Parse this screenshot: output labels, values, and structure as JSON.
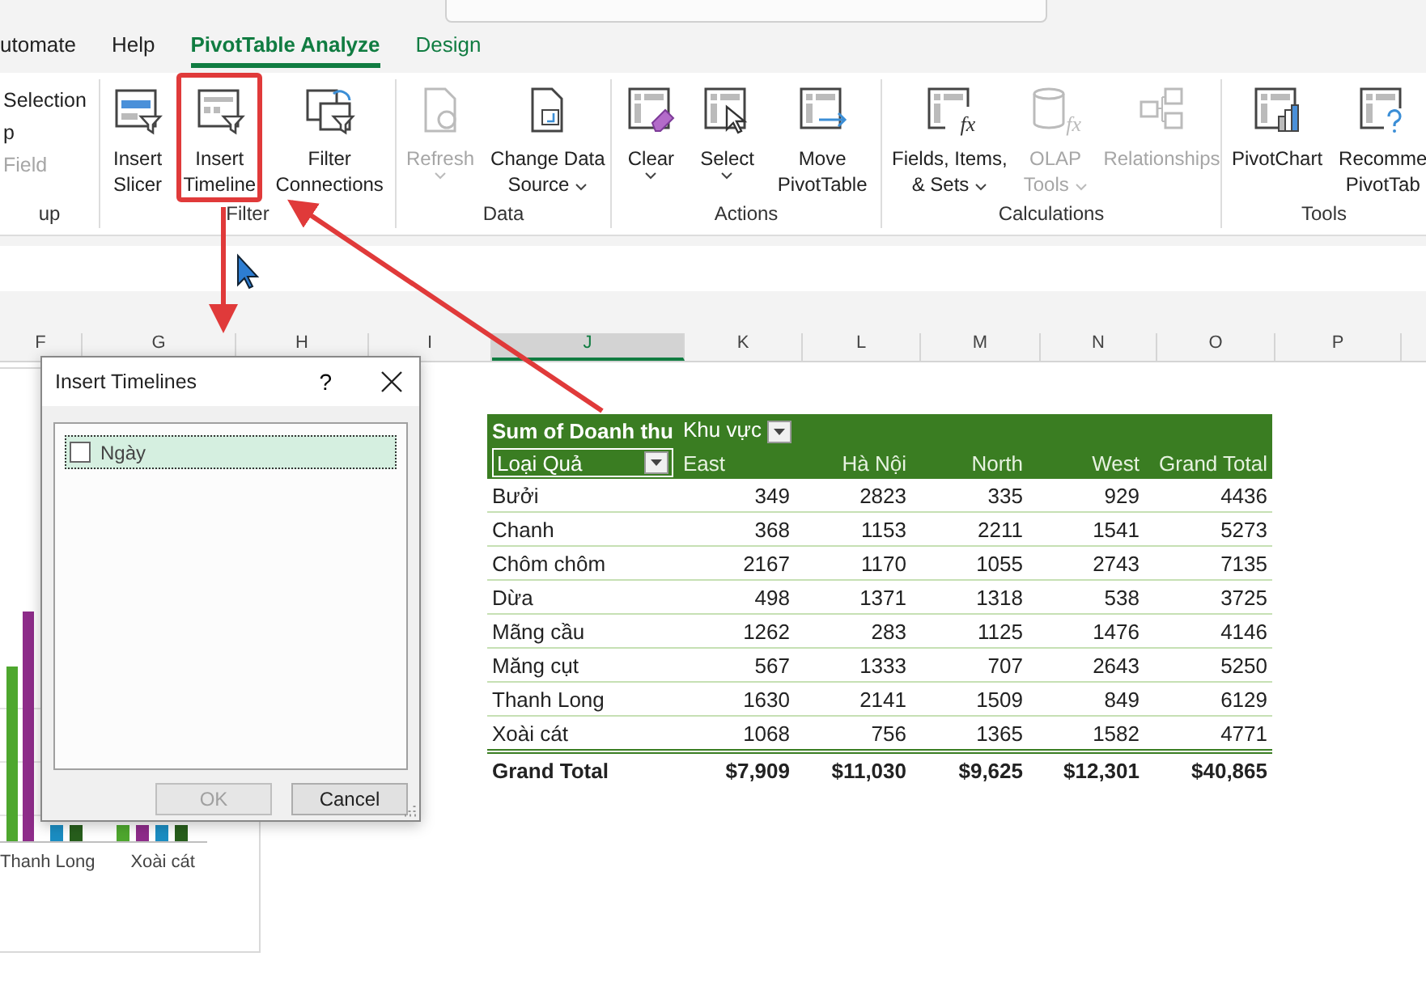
{
  "ribbon_tabs": [
    {
      "label": "utomate",
      "kind": "standard",
      "selected": false
    },
    {
      "label": "Help",
      "kind": "standard",
      "selected": false
    },
    {
      "label": "PivotTable Analyze",
      "kind": "contextual",
      "selected": true
    },
    {
      "label": "Design",
      "kind": "contextual",
      "selected": false
    }
  ],
  "ribbon_groups": [
    {
      "label": "up",
      "items": [
        {
          "kind": "small",
          "lines": [
            "Selection"
          ],
          "disabled": false
        },
        {
          "kind": "small",
          "lines": [
            "p"
          ],
          "disabled": false
        },
        {
          "kind": "small",
          "lines": [
            "Field"
          ],
          "disabled": true
        }
      ]
    },
    {
      "label": "Filter",
      "items": [
        {
          "kind": "large",
          "lines": [
            "Insert",
            "Slicer"
          ],
          "disabled": false,
          "dropdown": false,
          "highlighted": false
        },
        {
          "kind": "large",
          "lines": [
            "Insert",
            "Timeline"
          ],
          "disabled": false,
          "dropdown": false,
          "highlighted": true
        },
        {
          "kind": "large",
          "lines": [
            "Filter",
            "Connections"
          ],
          "disabled": false,
          "dropdown": false,
          "highlighted": false
        }
      ]
    },
    {
      "label": "Data",
      "items": [
        {
          "kind": "large",
          "lines": [
            "Refresh"
          ],
          "disabled": true,
          "dropdown": true,
          "highlighted": false
        },
        {
          "kind": "large",
          "lines": [
            "Change Data",
            "Source"
          ],
          "disabled": false,
          "dropdown": true,
          "highlighted": false
        }
      ]
    },
    {
      "label": "Actions",
      "items": [
        {
          "kind": "large",
          "lines": [
            "Clear"
          ],
          "disabled": false,
          "dropdown": true,
          "highlighted": false
        },
        {
          "kind": "large",
          "lines": [
            "Select"
          ],
          "disabled": false,
          "dropdown": true,
          "highlighted": false
        },
        {
          "kind": "large",
          "lines": [
            "Move",
            "PivotTable"
          ],
          "disabled": false,
          "dropdown": false,
          "highlighted": false
        }
      ]
    },
    {
      "label": "Calculations",
      "items": [
        {
          "kind": "large",
          "lines": [
            "Fields, Items,",
            "& Sets"
          ],
          "icon_text": "fx",
          "disabled": false,
          "dropdown": true,
          "highlighted": false
        },
        {
          "kind": "large",
          "lines": [
            "OLAP",
            "Tools"
          ],
          "icon_text": "fx",
          "disabled": true,
          "dropdown": true,
          "highlighted": false
        },
        {
          "kind": "large",
          "lines": [
            "Relationships"
          ],
          "disabled": true,
          "dropdown": false,
          "highlighted": false
        }
      ]
    },
    {
      "label": "Tools",
      "items": [
        {
          "kind": "large",
          "lines": [
            "PivotChart"
          ],
          "disabled": false,
          "dropdown": false,
          "highlighted": false
        },
        {
          "kind": "large",
          "lines": [
            "Recomme",
            "PivotTab"
          ],
          "disabled": false,
          "dropdown": false,
          "highlighted": false
        }
      ]
    }
  ],
  "column_headers": [
    {
      "label": "F",
      "selected": false
    },
    {
      "label": "G",
      "selected": false
    },
    {
      "label": "H",
      "selected": false
    },
    {
      "label": "I",
      "selected": false
    },
    {
      "label": "J",
      "selected": true
    },
    {
      "label": "K",
      "selected": false
    },
    {
      "label": "L",
      "selected": false
    },
    {
      "label": "M",
      "selected": false
    },
    {
      "label": "N",
      "selected": false
    },
    {
      "label": "O",
      "selected": false
    },
    {
      "label": "P",
      "selected": false
    }
  ],
  "chart": {
    "category_labels": [
      "Thanh Long",
      "Xoài cát"
    ]
  },
  "dialog": {
    "title": "Insert Timelines",
    "help": "?",
    "fields": [
      {
        "label": "Ngày",
        "checked": false,
        "selected": true
      }
    ],
    "buttons": [
      {
        "label": "OK",
        "disabled": true
      },
      {
        "label": "Cancel",
        "disabled": false
      }
    ]
  },
  "pivot": {
    "value_header": "Sum of Doanh thu",
    "column_field": "Khu vực",
    "row_field": "Loại Quả",
    "columns": [
      "East",
      "Hà Nội",
      "North",
      "West",
      "Grand Total"
    ],
    "rows": [
      {
        "label": "Bưởi",
        "values": [
          "349",
          "2823",
          "335",
          "929",
          "4436"
        ]
      },
      {
        "label": "Chanh",
        "values": [
          "368",
          "1153",
          "2211",
          "1541",
          "5273"
        ]
      },
      {
        "label": "Chôm chôm",
        "values": [
          "2167",
          "1170",
          "1055",
          "2743",
          "7135"
        ]
      },
      {
        "label": "Dừa",
        "values": [
          "498",
          "1371",
          "1318",
          "538",
          "3725"
        ]
      },
      {
        "label": "Mãng cầu",
        "values": [
          "1262",
          "283",
          "1125",
          "1476",
          "4146"
        ]
      },
      {
        "label": "Măng cụt",
        "values": [
          "567",
          "1333",
          "707",
          "2643",
          "5250"
        ]
      },
      {
        "label": "Thanh Long",
        "values": [
          "1630",
          "2141",
          "1509",
          "849",
          "6129"
        ]
      },
      {
        "label": "Xoài cát",
        "values": [
          "1068",
          "756",
          "1365",
          "1582",
          "4771"
        ]
      }
    ],
    "total": {
      "label": "Grand Total",
      "values": [
        "$7,909",
        "$11,030",
        "$9,625",
        "$12,301",
        "$40,865"
      ]
    }
  }
}
